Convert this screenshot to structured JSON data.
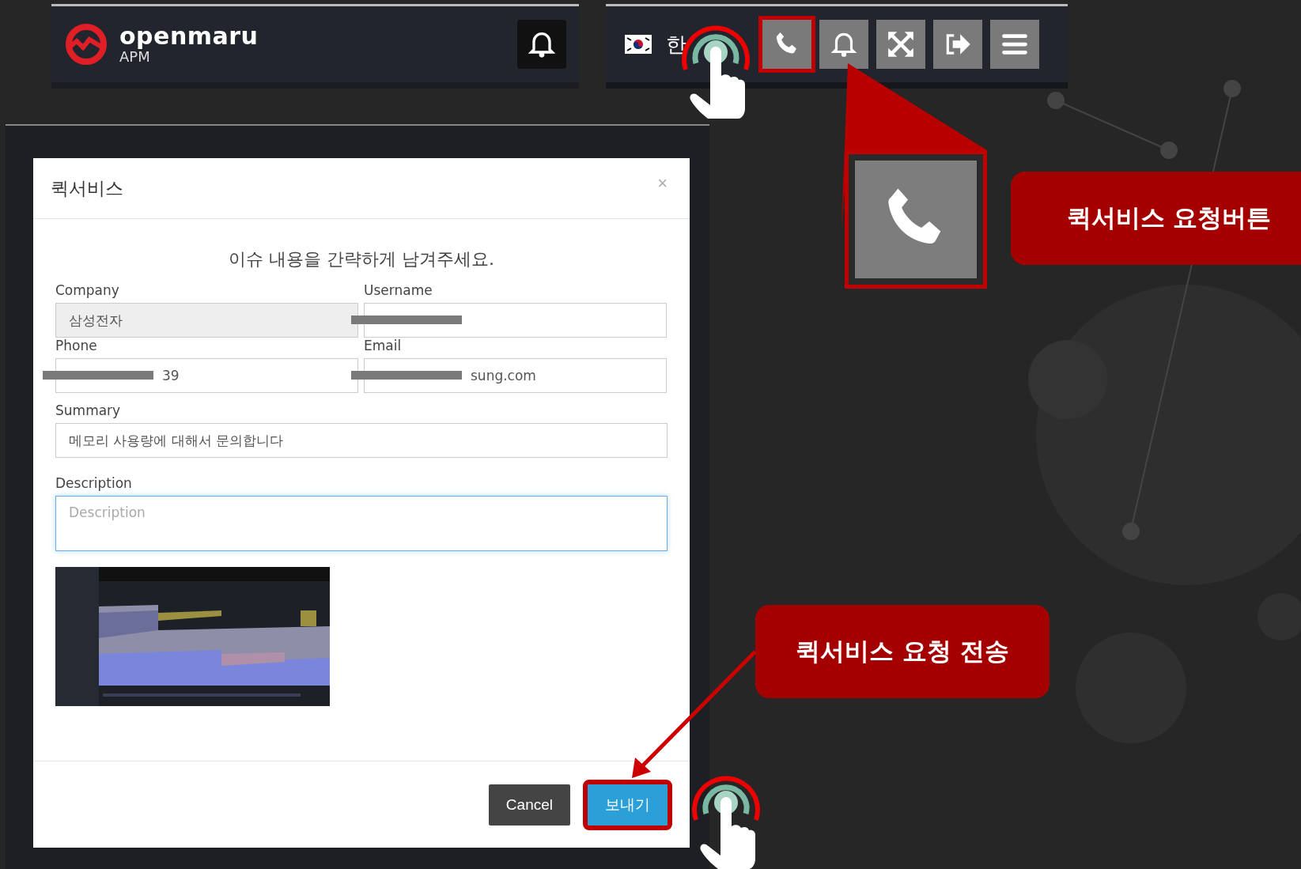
{
  "header": {
    "logo_name": "openmaru",
    "logo_sub": "APM"
  },
  "toolbar": {
    "language": "한",
    "buttons": [
      {
        "kind": "phone",
        "highlighted": true
      },
      {
        "kind": "bell",
        "highlighted": false
      },
      {
        "kind": "fullscreen",
        "highlighted": false
      },
      {
        "kind": "logout",
        "highlighted": false
      },
      {
        "kind": "menu",
        "highlighted": false
      }
    ]
  },
  "modal": {
    "title": "퀵서비스",
    "close": "×",
    "prompt": "이슈 내용을 간략하게 남겨주세요.",
    "fields": [
      {
        "label": "Company",
        "value": "삼성전자",
        "disabled": true
      },
      {
        "label": "Username",
        "disabled": false,
        "redacted": true
      },
      {
        "label": "Phone",
        "value": "39",
        "disabled": false,
        "redacted": true
      },
      {
        "label": "Email",
        "value": "sung.com",
        "disabled": false,
        "redacted": true
      }
    ],
    "summary": {
      "label": "Summary",
      "value": "메모리 사용량에 대해서 문의합니다"
    },
    "description": {
      "label": "Description",
      "placeholder": "Description"
    },
    "buttons": [
      {
        "label": "Cancel",
        "kind": "secondary",
        "highlighted": false
      },
      {
        "label": "보내기",
        "kind": "primary",
        "highlighted": true
      }
    ]
  },
  "annotations": [
    {
      "text": "퀵서비스 요청버튼"
    },
    {
      "text": "퀵서비스 요청 전송"
    }
  ]
}
